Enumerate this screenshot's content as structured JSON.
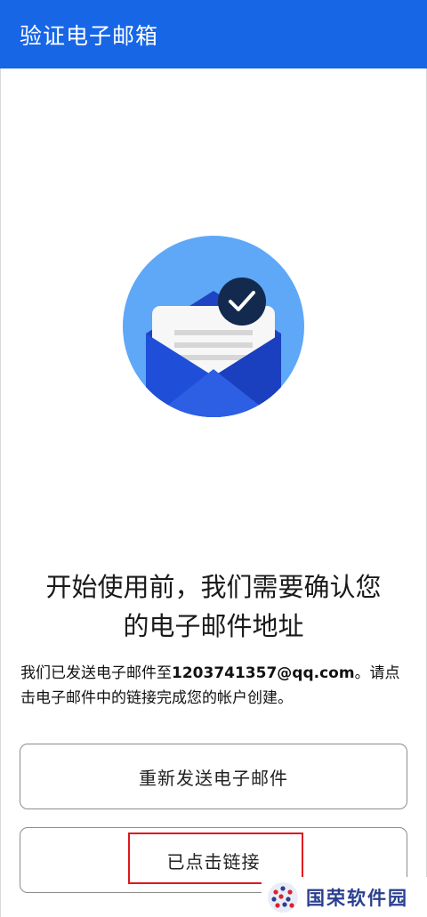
{
  "appbar": {
    "title": "验证电子邮箱"
  },
  "headline": {
    "line1": "开始使用前，我们需要确认您",
    "line2": "的电子邮件地址"
  },
  "description": {
    "prefix": "我们已发送电子邮件至",
    "email": "1203741357@qq.com",
    "suffix": "。请点击电子邮件中的链接完成您的帐户创建。"
  },
  "buttons": {
    "resend": "重新发送电子邮件",
    "clicked": "已点击链接"
  },
  "watermark": {
    "text": "国荣软件园"
  },
  "colors": {
    "brand_blue": "#1666e6",
    "highlight_red": "#e0161e",
    "circle_blue": "#5ea8f7",
    "badge_navy": "#132a4e"
  }
}
